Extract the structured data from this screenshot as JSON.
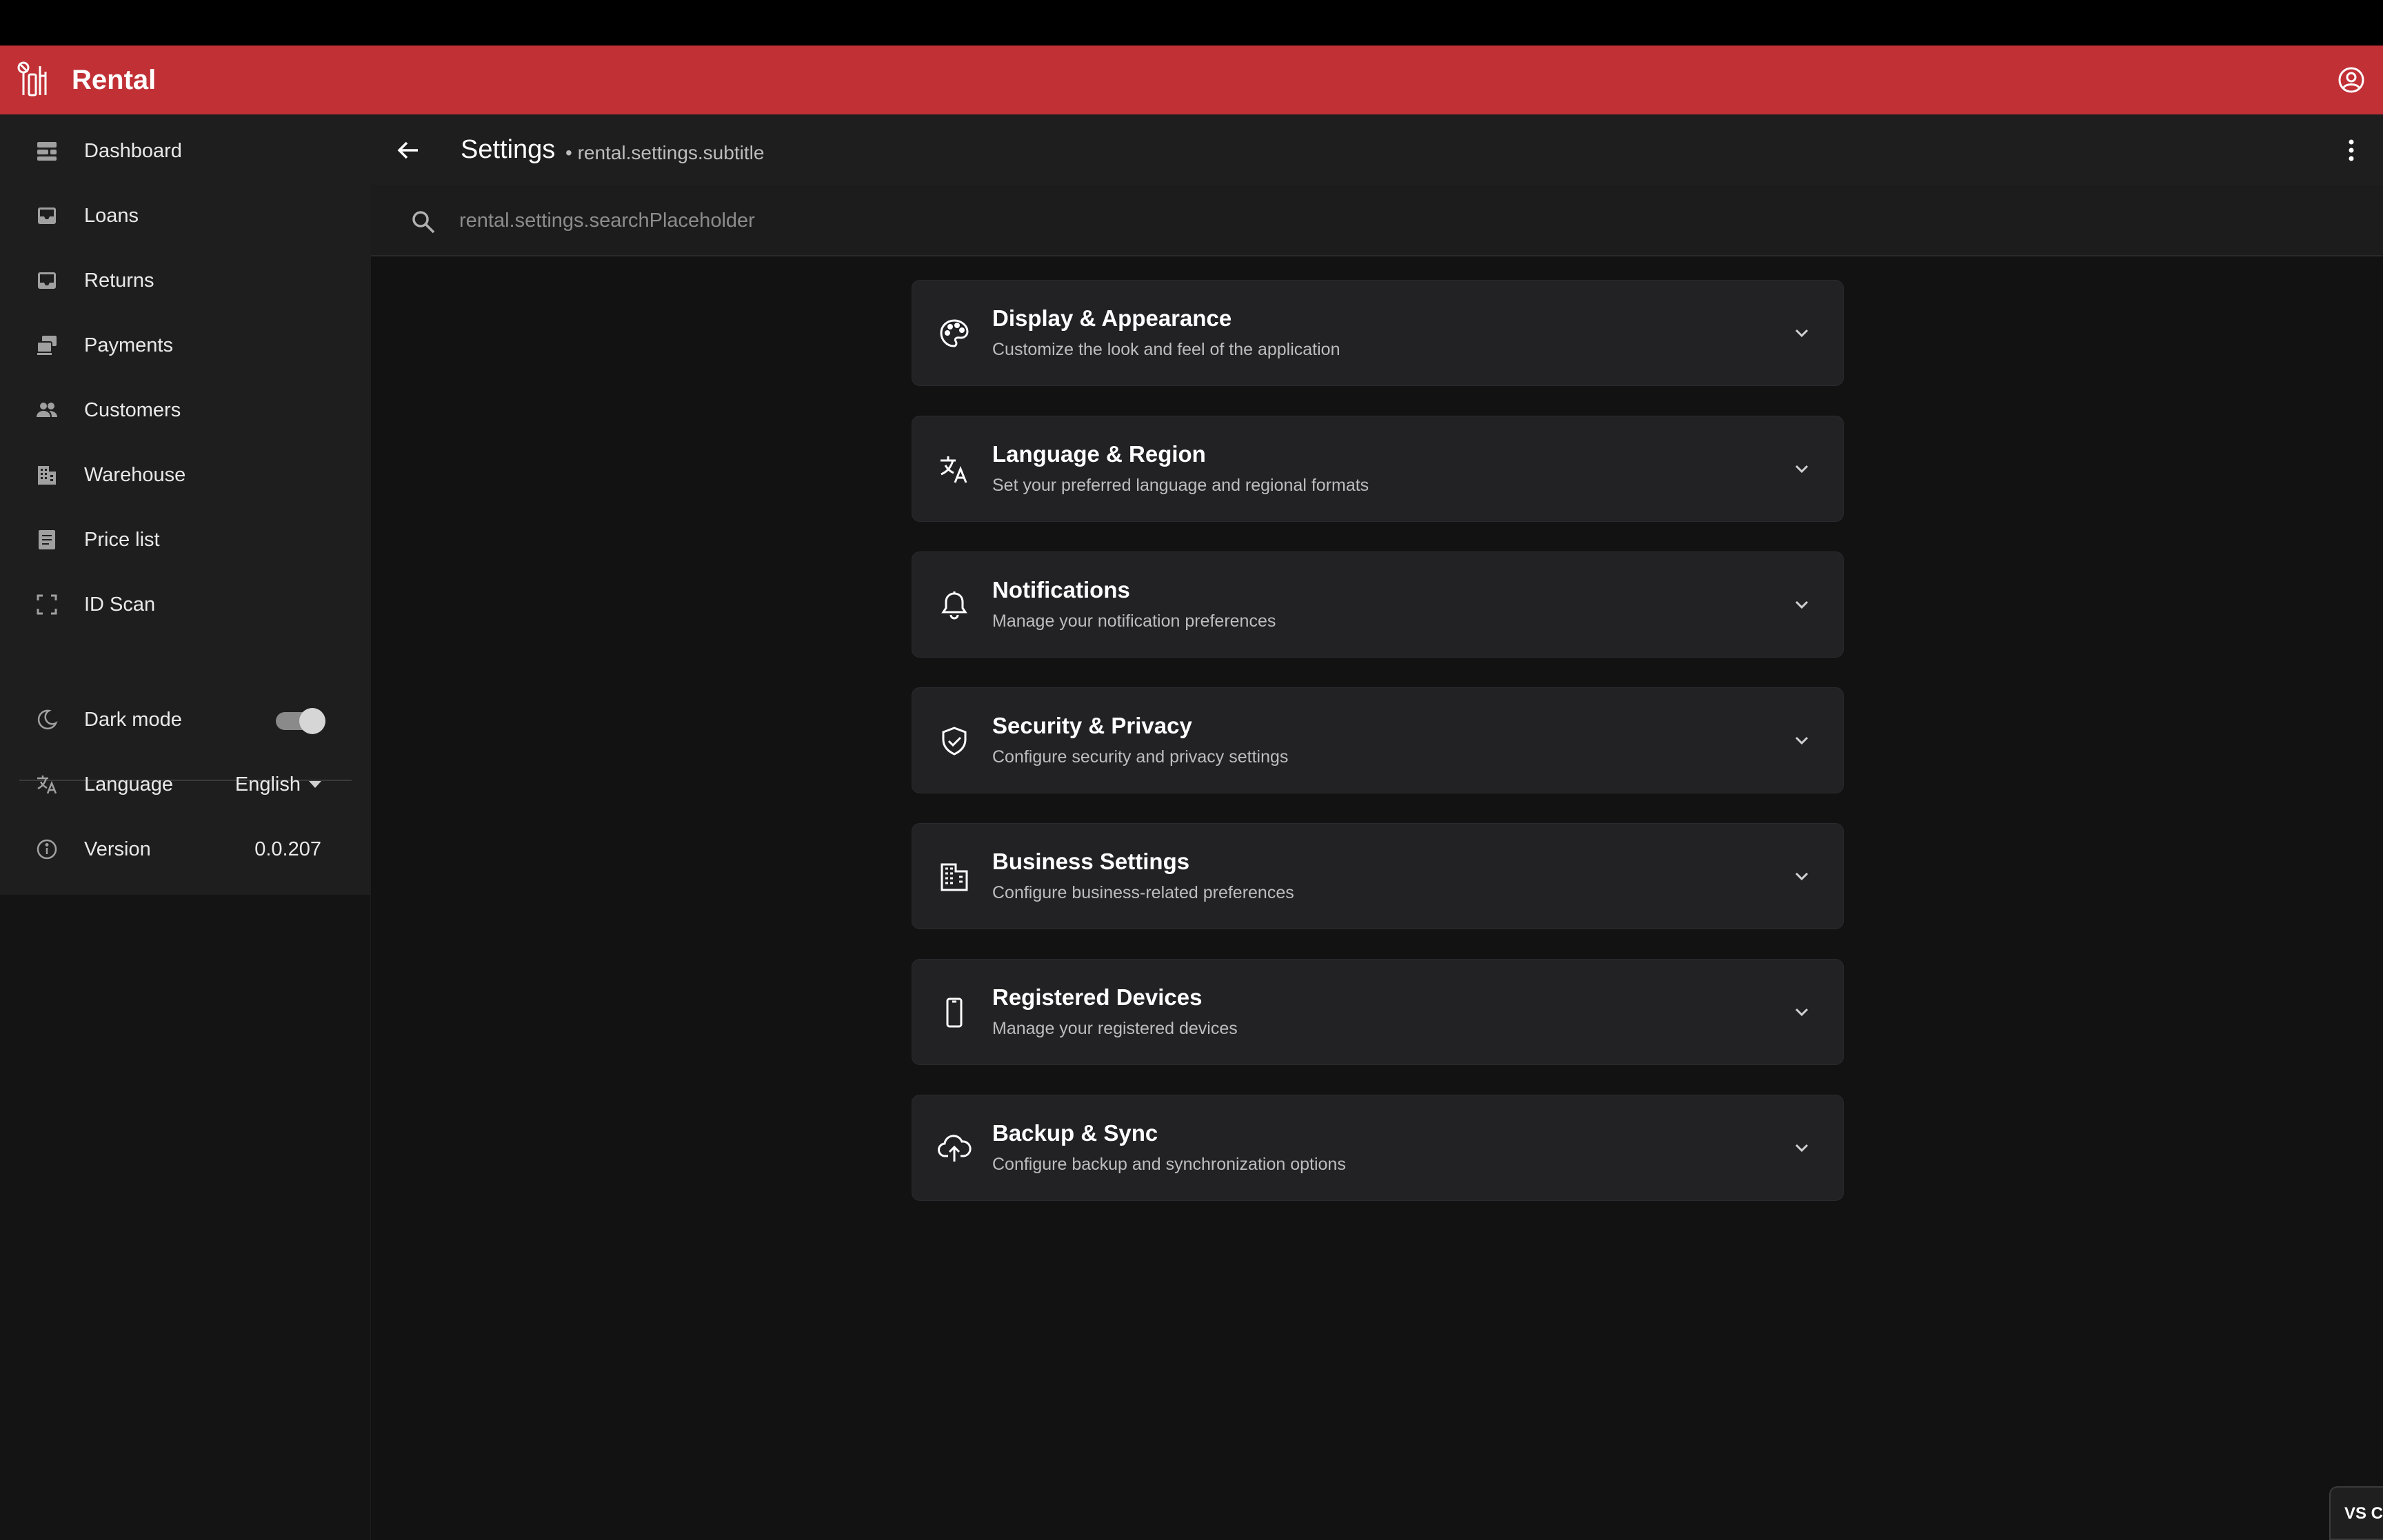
{
  "app": {
    "title": "Rental",
    "brand_color": "#c03035",
    "logo_icon": "tools-icon",
    "account_icon": "account-circle-icon"
  },
  "sidebar": {
    "items": [
      {
        "label": "Dashboard",
        "icon": "dashboard-icon"
      },
      {
        "label": "Loans",
        "icon": "inbox-upload-icon"
      },
      {
        "label": "Returns",
        "icon": "inbox-icon"
      },
      {
        "label": "Payments",
        "icon": "payments-icon"
      },
      {
        "label": "Customers",
        "icon": "people-icon"
      },
      {
        "label": "Warehouse",
        "icon": "building-icon"
      },
      {
        "label": "Price list",
        "icon": "document-icon"
      },
      {
        "label": "ID Scan",
        "icon": "scan-frame-icon"
      }
    ],
    "dark_mode": {
      "label": "Dark mode",
      "icon": "moon-icon",
      "enabled": true
    },
    "language": {
      "label": "Language",
      "icon": "translate-icon",
      "value": "English"
    },
    "version": {
      "label": "Version",
      "icon": "info-icon",
      "value": "0.0.207"
    }
  },
  "header": {
    "title": "Settings",
    "subtitle": "• rental.settings.subtitle",
    "back_icon": "arrow-left-icon",
    "more_icon": "more-vertical-icon"
  },
  "search": {
    "placeholder": "rental.settings.searchPlaceholder",
    "value": ""
  },
  "sections": [
    {
      "title": "Display & Appearance",
      "description": "Customize the look and feel of the application",
      "icon": "palette-icon"
    },
    {
      "title": "Language & Region",
      "description": "Set your preferred language and regional formats",
      "icon": "translate-icon"
    },
    {
      "title": "Notifications",
      "description": "Manage your notification preferences",
      "icon": "bell-icon"
    },
    {
      "title": "Security & Privacy",
      "description": "Configure security and privacy settings",
      "icon": "shield-check-icon"
    },
    {
      "title": "Business Settings",
      "description": "Configure business-related preferences",
      "icon": "business-building-icon"
    },
    {
      "title": "Registered Devices",
      "description": "Manage your registered devices",
      "icon": "smartphone-icon"
    },
    {
      "title": "Backup & Sync",
      "description": "Configure backup and synchronization options",
      "icon": "cloud-upload-icon"
    }
  ],
  "corner_badge": {
    "label": "VS C"
  }
}
